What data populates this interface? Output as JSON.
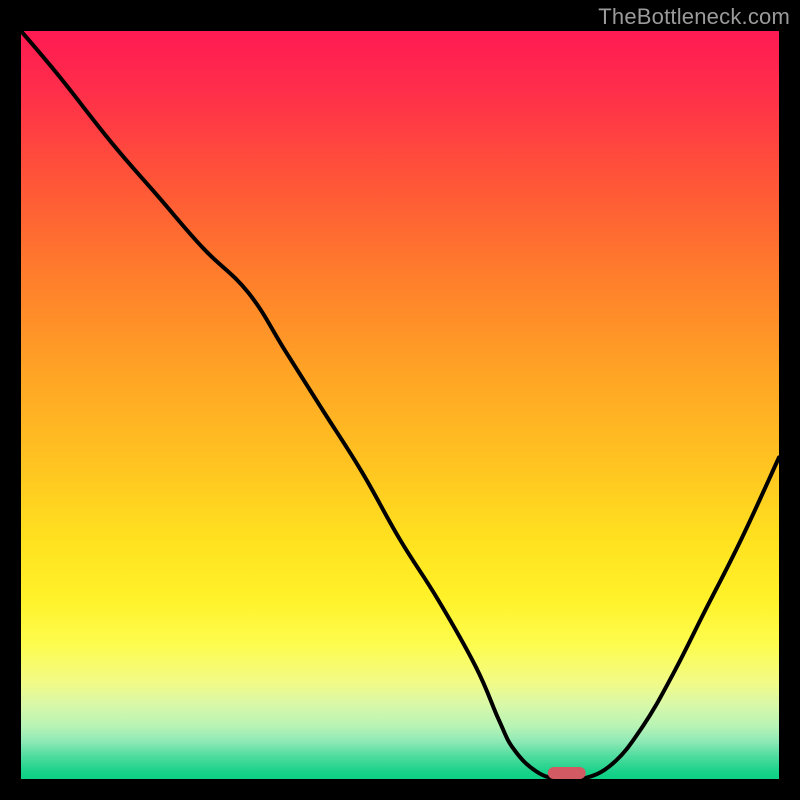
{
  "attribution": "TheBottleneck.com",
  "colors": {
    "curve_stroke": "#000000",
    "marker_fill": "#d15a63",
    "frame_bg": "#000000"
  },
  "chart_data": {
    "type": "line",
    "title": "",
    "xlabel": "",
    "ylabel": "",
    "xlim": [
      0,
      100
    ],
    "ylim": [
      0,
      100
    ],
    "series": [
      {
        "name": "bottleneck-curve",
        "x": [
          0,
          5,
          12,
          18,
          24,
          30,
          35,
          40,
          45,
          50,
          55,
          60,
          63,
          65,
          68,
          71,
          74,
          78,
          82,
          86,
          90,
          95,
          100
        ],
        "y": [
          100,
          94,
          85,
          78,
          71,
          65,
          57,
          49,
          41,
          32,
          24,
          15,
          8,
          4,
          1,
          0,
          0,
          2,
          7,
          14,
          22,
          32,
          43
        ]
      }
    ],
    "marker": {
      "x": 72,
      "y": 0,
      "width_pct": 5.0,
      "height_pct": 1.6
    }
  }
}
